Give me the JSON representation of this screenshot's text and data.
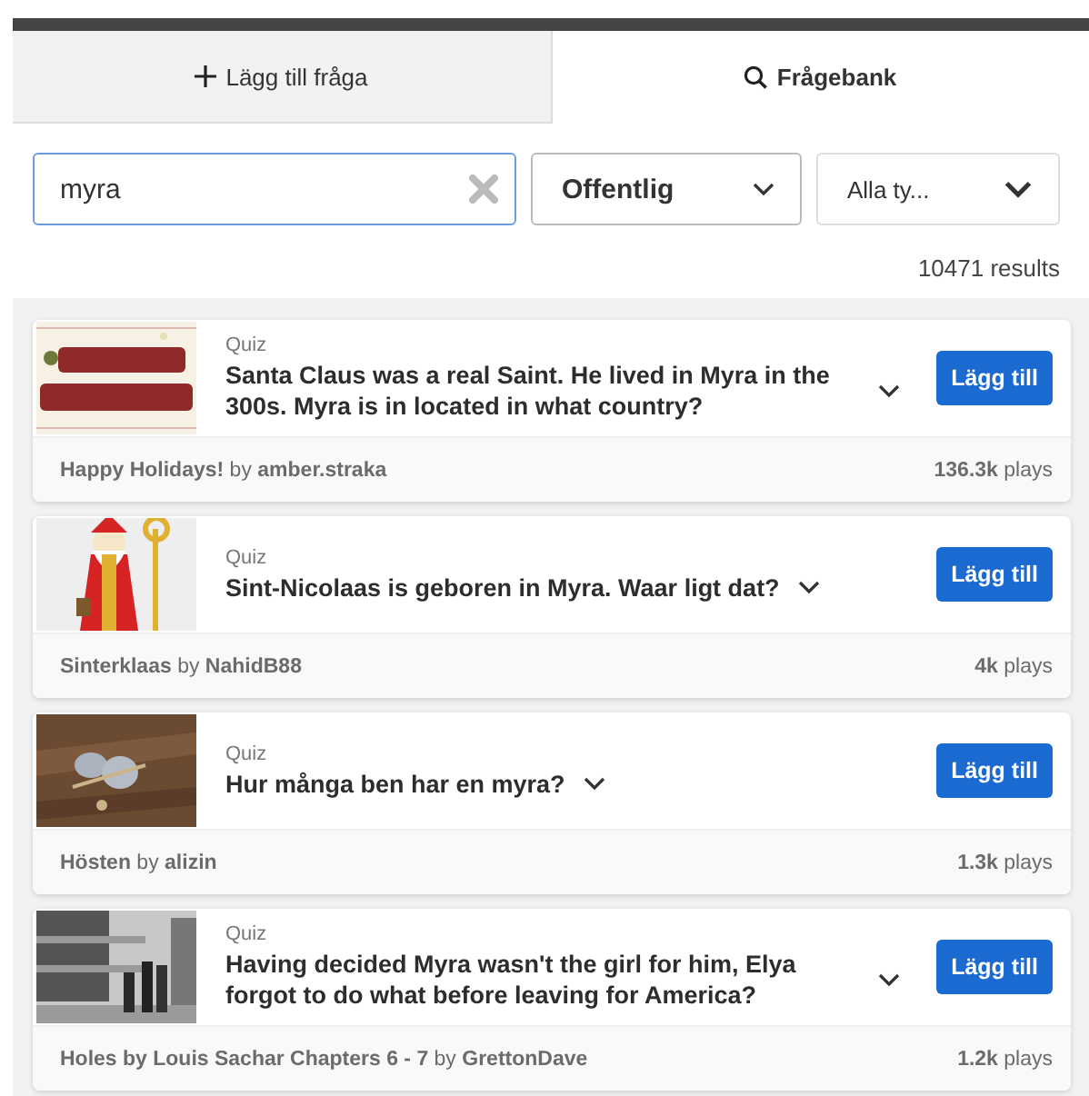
{
  "tabs": [
    {
      "kind": "add",
      "label": "Lägg till fråga",
      "selected": false
    },
    {
      "kind": "search",
      "label": "Frågebank",
      "selected": true
    }
  ],
  "search": {
    "value": "myra"
  },
  "filters": [
    {
      "value": "Offentlig"
    },
    {
      "value": "Alla ty..."
    }
  ],
  "results": "10471 results",
  "cards": [
    {
      "type": "Quiz",
      "question": "Santa Claus was a real Saint. He lived in Myra in the 300s. Myra is in located in what country?",
      "button": "Lägg till",
      "source": "**Happy Holidays!** by **amber.straka**",
      "plays": "**136.3k** plays"
    },
    {
      "type": "Quiz",
      "question": "Sint-Nicolaas is geboren in Myra. Waar ligt dat?",
      "button": "Lägg till",
      "source": "**Sinterklaas** by **NahidB88**",
      "plays": "**4k** plays"
    },
    {
      "type": "Quiz",
      "question": "Hur många ben har en myra?",
      "button": "Lägg till",
      "source": "**Hösten** by **alizin**",
      "plays": "**1.3k** plays"
    },
    {
      "type": "Quiz",
      "question": "Having decided Myra wasn't the girl for him, Elya forgot to do what before leaving for America?",
      "button": "Lägg till",
      "source": "**Holes by Louis Sachar Chapters 6 - 7** by **GrettonDave**",
      "plays": "**1.2k** plays"
    }
  ]
}
